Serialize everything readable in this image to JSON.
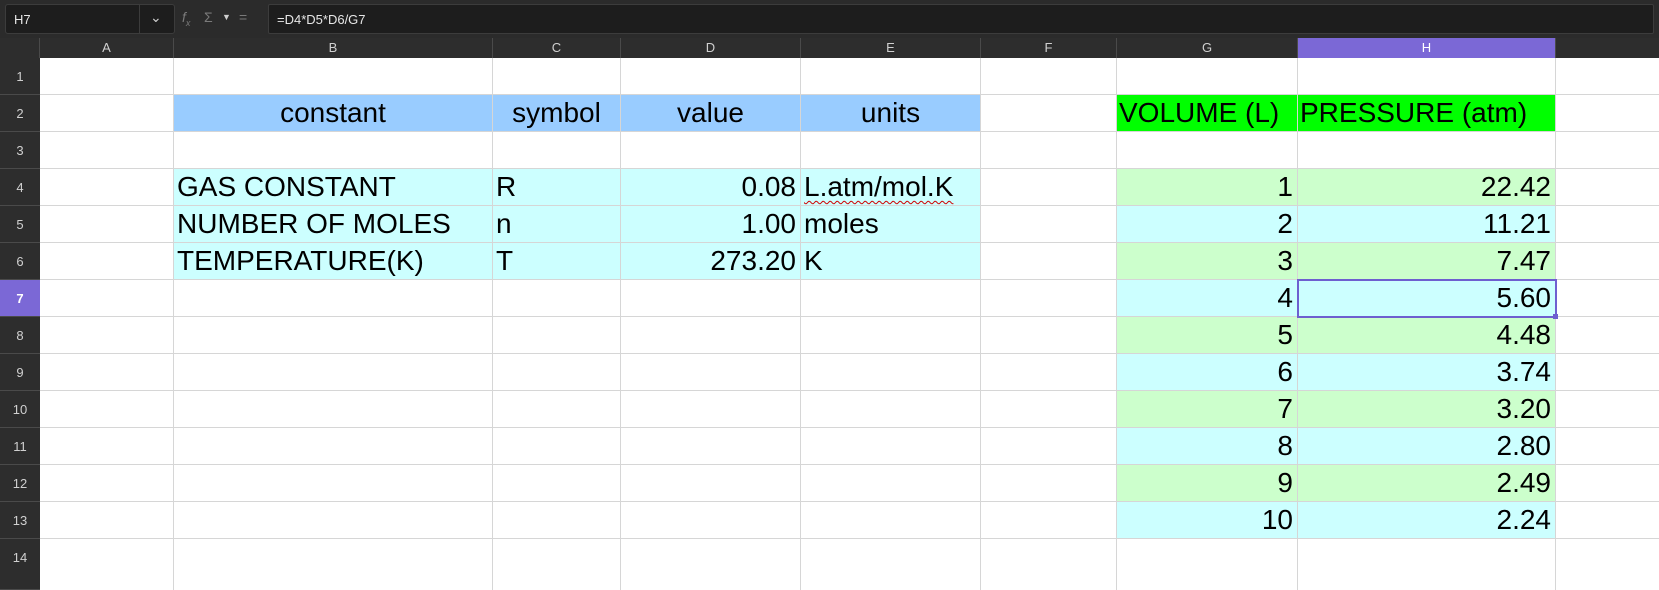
{
  "name_box": "H7",
  "formula": "=D4*D5*D6/G7",
  "toolbar_icons": [
    "function-wizard-icon",
    "sum-icon",
    "chevron-down-icon",
    "formula-icon"
  ],
  "columns": [
    "A",
    "B",
    "C",
    "D",
    "E",
    "F",
    "G",
    "H"
  ],
  "rows": [
    "1",
    "2",
    "3",
    "4",
    "5",
    "6",
    "7",
    "8",
    "9",
    "10",
    "11",
    "12",
    "13",
    "14"
  ],
  "selected_column": "H",
  "selected_row": "7",
  "colors": {
    "header_blue": "#99ccff",
    "table_cyan": "#ccffff",
    "header_green": "#00ff00",
    "row_green": "#ccffcc",
    "selection": "#7b68d6"
  },
  "constants_table": {
    "headers": {
      "constant": "constant",
      "symbol": "symbol",
      "value": "value",
      "units": "units"
    },
    "rows": [
      {
        "constant": "GAS CONSTANT",
        "symbol": "R",
        "value": "0.08",
        "units": "L.atm/mol.K"
      },
      {
        "constant": "NUMBER OF MOLES",
        "symbol": "n",
        "value": "1.00",
        "units": "moles"
      },
      {
        "constant": "TEMPERATURE(K)",
        "symbol": "T",
        "value": "273.20",
        "units": "K"
      }
    ]
  },
  "pv_table": {
    "volume_header": "VOLUME (L)",
    "pressure_header": "PRESSURE (atm)",
    "rows": [
      {
        "v": "1",
        "p": "22.42"
      },
      {
        "v": "2",
        "p": "11.21"
      },
      {
        "v": "3",
        "p": "7.47"
      },
      {
        "v": "4",
        "p": "5.60"
      },
      {
        "v": "5",
        "p": "4.48"
      },
      {
        "v": "6",
        "p": "3.74"
      },
      {
        "v": "7",
        "p": "3.20"
      },
      {
        "v": "8",
        "p": "2.80"
      },
      {
        "v": "9",
        "p": "2.49"
      },
      {
        "v": "10",
        "p": "2.24"
      }
    ]
  }
}
